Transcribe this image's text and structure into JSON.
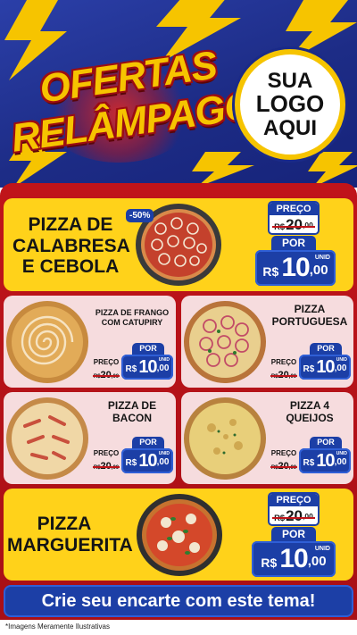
{
  "header": {
    "title_line1": "OFERTAS",
    "title_line2": "RELÂMPAGO",
    "logo": [
      "SUA",
      "LOGO",
      "AQUI"
    ]
  },
  "featured_top": {
    "name": [
      "PIZZA DE",
      "CALABRESA",
      "E CEBOLA"
    ],
    "discount_badge": "-50%",
    "preco_label": "PREÇO",
    "old_price_currency": "R$",
    "old_price_int": "20",
    "old_price_cents": ",00",
    "por_label": "POR",
    "price_currency": "R$",
    "price_int": "10",
    "price_cents": ",00",
    "unit": "UNID",
    "pizza_icon": "pepperoni-onion-pizza"
  },
  "grid": [
    {
      "name": [
        "PIZZA DE FRANGO",
        "COM CATUPIRY"
      ],
      "preco_label": "PREÇO",
      "old_currency": "R$",
      "old_int": "20",
      "old_cents": ",00",
      "por_label": "POR",
      "currency": "R$",
      "price_int": "10",
      "price_cents": ",00",
      "unit": "UNID"
    },
    {
      "name": [
        "PIZZA",
        "PORTUGUESA"
      ],
      "preco_label": "PREÇO",
      "old_currency": "R$",
      "old_int": "20",
      "old_cents": ",00",
      "por_label": "POR",
      "currency": "R$",
      "price_int": "10",
      "price_cents": ",00",
      "unit": "UNID"
    },
    {
      "name": [
        "PIZZA DE",
        "BACON"
      ],
      "preco_label": "PREÇO",
      "old_currency": "R$",
      "old_int": "20",
      "old_cents": ",00",
      "por_label": "POR",
      "currency": "R$",
      "price_int": "10",
      "price_cents": ",00",
      "unit": "UNID"
    },
    {
      "name": [
        "PIZZA 4",
        "QUEIJOS"
      ],
      "preco_label": "PREÇO",
      "old_currency": "R$",
      "old_int": "20",
      "old_cents": ",00",
      "por_label": "POR",
      "currency": "R$",
      "price_int": "10",
      "price_cents": ",00",
      "unit": "UNID"
    }
  ],
  "featured_bottom": {
    "name": [
      "PIZZA",
      "MARGUERITA"
    ],
    "preco_label": "PREÇO",
    "old_price_currency": "R$",
    "old_price_int": "20",
    "old_price_cents": ",00",
    "por_label": "POR",
    "price_currency": "R$",
    "price_int": "10",
    "price_cents": ",00",
    "unit": "UNID"
  },
  "cta": "Crie seu encarte com este tema!",
  "footnote": "*Imagens Meramente Ilustrativas",
  "colors": {
    "header_blue": "#1d2c86",
    "panel_red": "#c0141a",
    "card_yellow": "#ffd21a",
    "card_pink": "#f6dcde",
    "price_blue": "#1c3fa6",
    "title_gold": "#f6c400"
  }
}
